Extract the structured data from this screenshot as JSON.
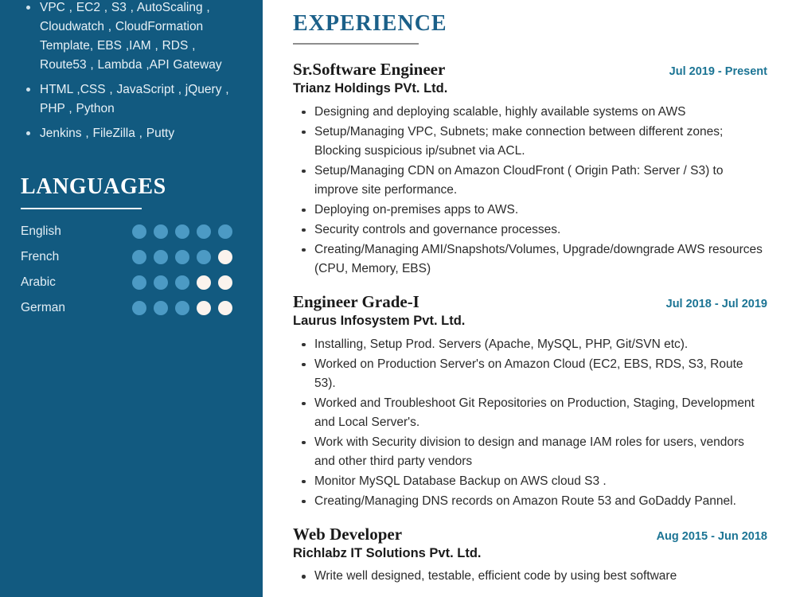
{
  "sidebar": {
    "skills": [
      "VPC , EC2 , S3 , AutoScaling , Cloudwatch , CloudFormation Template, EBS ,IAM , RDS , Route53 , Lambda ,API Gateway",
      "HTML ,CSS , JavaScript , jQuery , PHP , Python",
      "Jenkins , FileZilla , Putty"
    ],
    "languages_heading": "LANGUAGES",
    "languages": [
      {
        "name": "English",
        "level": 5,
        "total": 5
      },
      {
        "name": "French",
        "level": 4,
        "total": 5
      },
      {
        "name": "Arabic",
        "level": 3,
        "total": 5
      },
      {
        "name": "German",
        "level": 3,
        "total": 5
      }
    ]
  },
  "main": {
    "heading": "EXPERIENCE",
    "jobs": [
      {
        "title": "Sr.Software Engineer",
        "company": "Trianz Holdings PVt. Ltd.",
        "dates": "Jul 2019 - Present",
        "bullets": [
          "Designing and deploying scalable, highly available systems on AWS",
          "Setup/Managing VPC, Subnets; make connection between different zones; Blocking suspicious ip/subnet via ACL.",
          "Setup/Managing CDN on Amazon CloudFront ( Origin Path: Server / S3) to improve site performance.",
          "Deploying on-premises apps to AWS.",
          "Security controls and governance processes.",
          "Creating/Managing AMI/Snapshots/Volumes, Upgrade/downgrade AWS resources (CPU, Memory, EBS)"
        ]
      },
      {
        "title": "Engineer Grade-I",
        "company": "Laurus Infosystem Pvt. Ltd.",
        "dates": "Jul 2018 - Jul 2019",
        "bullets": [
          "Installing, Setup Prod. Servers (Apache, MySQL, PHP,  Git/SVN etc).",
          "Worked on Production Server's on Amazon Cloud (EC2, EBS, RDS, S3, Route 53).",
          "Worked and Troubleshoot Git Repositories on Production, Staging, Development and Local Server's.",
          "Work with Security division to design and manage IAM roles for users, vendors and other third party vendors",
          "Monitor MySQL Database Backup on AWS cloud S3 .",
          "Creating/Managing DNS records on Amazon Route 53 and GoDaddy Pannel."
        ]
      },
      {
        "title": "Web Developer",
        "company": "Richlabz IT Solutions Pvt. Ltd.",
        "dates": "Aug 2015 - Jun 2018",
        "bullets": [
          "Write well designed, testable, efficient code by using best software"
        ]
      }
    ]
  },
  "colors": {
    "sidebar_bg": "#125a80",
    "accent_blue": "#1b6089",
    "date_blue": "#1b7494",
    "dot_filled": "#4c9ac4",
    "dot_empty": "#fbf3ed"
  }
}
